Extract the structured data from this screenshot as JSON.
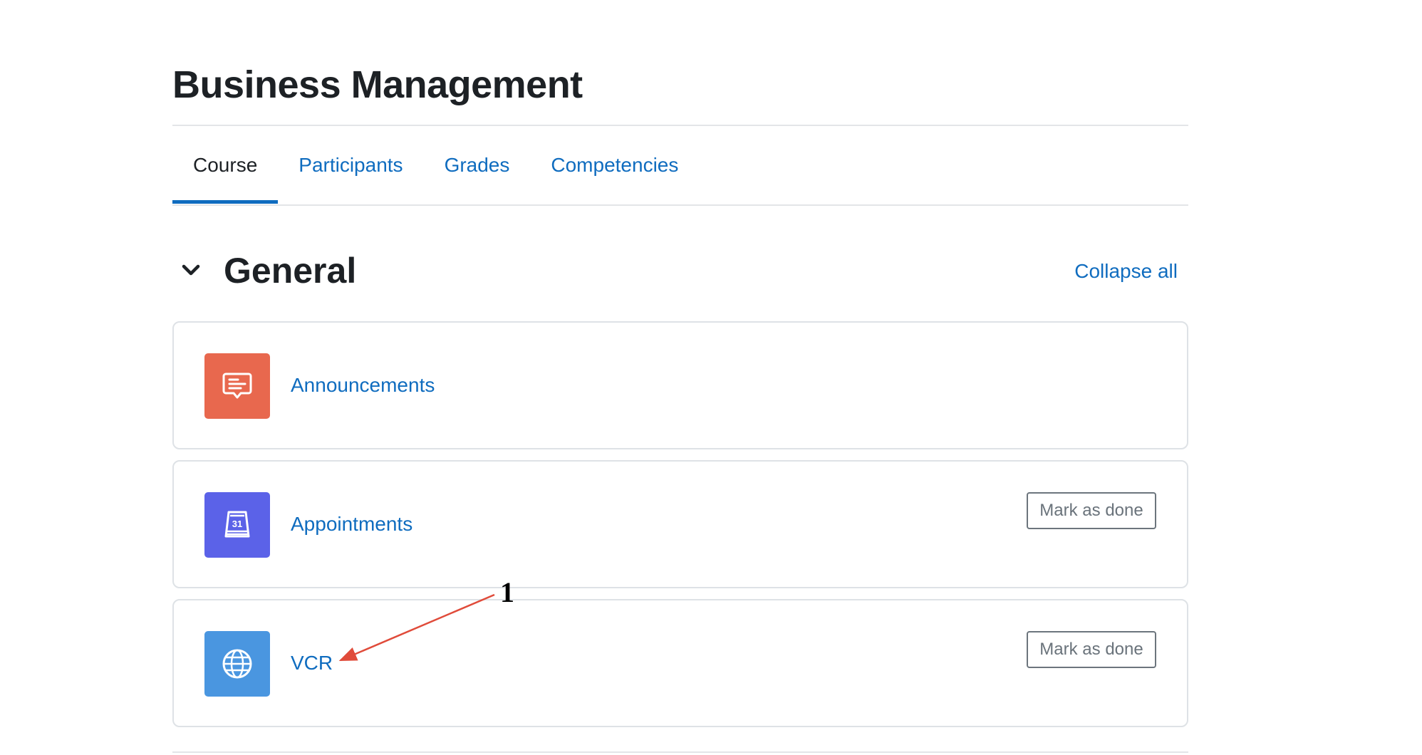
{
  "course": {
    "title": "Business Management"
  },
  "tabs": [
    {
      "label": "Course",
      "active": true
    },
    {
      "label": "Participants",
      "active": false
    },
    {
      "label": "Grades",
      "active": false
    },
    {
      "label": "Competencies",
      "active": false
    }
  ],
  "section": {
    "title": "General",
    "collapse_label": "Collapse all",
    "chevron_icon": "chevron-down-icon"
  },
  "activities": [
    {
      "name": "Announcements",
      "icon": "forum-icon",
      "icon_color": "#e8684e",
      "mark_label": ""
    },
    {
      "name": "Appointments",
      "icon": "calendar-icon",
      "icon_color": "#5b62e8",
      "mark_label": "Mark as done"
    },
    {
      "name": "VCR",
      "icon": "globe-icon",
      "icon_color": "#4a96e0",
      "mark_label": "Mark as done"
    }
  ],
  "annotation": {
    "label": "1",
    "color": "#e04b3a"
  },
  "colors": {
    "link": "#0f6cbf",
    "text": "#1d2125",
    "border": "#dee2e6"
  }
}
